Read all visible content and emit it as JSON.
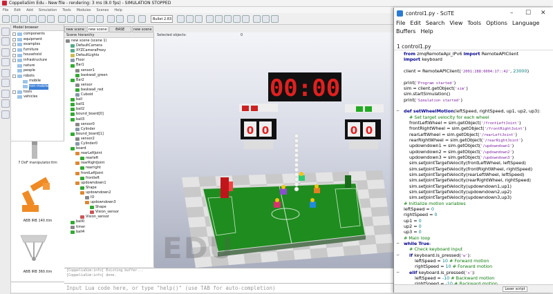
{
  "coppelia": {
    "title": "CoppeliaSim Edu - New file - rendering: 3 ms (8.0 fps) - SIMULATION STOPPED",
    "menu": [
      "File",
      "Edit",
      "Add",
      "Simulation",
      "Tools",
      "Modules",
      "Scenes",
      "Help"
    ],
    "engine_dropdown": "Bullet 2.83",
    "model_browser": {
      "header": "Model browser",
      "items": [
        {
          "label": "components",
          "fold": true
        },
        {
          "label": "equipment",
          "fold": true
        },
        {
          "label": "examples",
          "fold": true
        },
        {
          "label": "furniture",
          "fold": true
        },
        {
          "label": "household",
          "fold": true
        },
        {
          "label": "infrastructure",
          "fold": true
        },
        {
          "label": "nature",
          "fold": false
        },
        {
          "label": "people",
          "fold": false
        },
        {
          "label": "robots",
          "fold": true
        },
        {
          "label": "mobile",
          "fold": false,
          "indent": 1
        },
        {
          "label": "non-mobile",
          "fold": false,
          "indent": 1,
          "selected": true
        },
        {
          "label": "tools",
          "fold": true
        },
        {
          "label": "vehicles",
          "fold": false
        }
      ],
      "models": [
        "7 DoF manipulator.ttm",
        "ABB IRB 140.ttm",
        "ABB IRB 360.ttm"
      ]
    },
    "scene_tabs": [
      "new scene",
      "new scene",
      "BASE",
      "new scene"
    ],
    "scene_hierarchy": {
      "header": "Scene hierarchy",
      "rows": [
        {
          "label": "new scene (scene 1)",
          "indent": 0,
          "color": "#888"
        },
        {
          "label": "DefaultCamera",
          "indent": 1,
          "color": "#5a8"
        },
        {
          "label": "XYZCameraProxy",
          "indent": 1,
          "color": "#5a8"
        },
        {
          "label": "DefaultLights",
          "indent": 1,
          "color": "#cb5"
        },
        {
          "label": "Floor",
          "indent": 1,
          "color": "#89a"
        },
        {
          "label": "Bar1",
          "indent": 1,
          "color": "#3a3"
        },
        {
          "label": "sensor1",
          "indent": 2,
          "color": "#888"
        },
        {
          "label": "baskwall_green",
          "indent": 2,
          "color": "#3a3"
        },
        {
          "label": "Bar2",
          "indent": 1,
          "color": "#3a3"
        },
        {
          "label": "sensor",
          "indent": 2,
          "color": "#888"
        },
        {
          "label": "baskwall_red",
          "indent": 2,
          "color": "#3a3"
        },
        {
          "label": "Cuboid",
          "indent": 2,
          "color": "#89a"
        },
        {
          "label": "ball",
          "indent": 1,
          "color": "#3a3"
        },
        {
          "label": "ball1",
          "indent": 1,
          "color": "#3a3"
        },
        {
          "label": "ball2",
          "indent": 1,
          "color": "#3a3"
        },
        {
          "label": "bound_board[0]",
          "indent": 1,
          "color": "#3a3"
        },
        {
          "label": "ball3",
          "indent": 1,
          "color": "#3a3"
        },
        {
          "label": "sensor0",
          "indent": 2,
          "color": "#888"
        },
        {
          "label": "Cylinder",
          "indent": 2,
          "color": "#89a"
        },
        {
          "label": "bound_board[1]",
          "indent": 1,
          "color": "#3a3"
        },
        {
          "label": "sensor2",
          "indent": 2,
          "color": "#888"
        },
        {
          "label": "Cylinder0",
          "indent": 2,
          "color": "#89a"
        },
        {
          "label": "board",
          "indent": 1,
          "color": "#3a3"
        },
        {
          "label": "rearLeftJoint",
          "indent": 2,
          "color": "#d83"
        },
        {
          "label": "rearleft",
          "indent": 3,
          "color": "#3a3"
        },
        {
          "label": "rearRightJoint",
          "indent": 2,
          "color": "#d83"
        },
        {
          "label": "rearright",
          "indent": 3,
          "color": "#3a3"
        },
        {
          "label": "frontLeftJoint",
          "indent": 2,
          "color": "#d83"
        },
        {
          "label": "frontleft",
          "indent": 3,
          "color": "#3a3"
        },
        {
          "label": "updowndown1",
          "indent": 2,
          "color": "#d83"
        },
        {
          "label": "Shape",
          "indent": 3,
          "color": "#3a3"
        },
        {
          "label": "updowndown2",
          "indent": 3,
          "color": "#d83"
        },
        {
          "label": "IO",
          "indent": 4,
          "color": "#888"
        },
        {
          "label": "updowndown3",
          "indent": 4,
          "color": "#d83"
        },
        {
          "label": "Shape",
          "indent": 5,
          "color": "#3a3"
        },
        {
          "label": "Vision_sensor",
          "indent": 5,
          "color": "#c55"
        },
        {
          "label": "Vision_sensor",
          "indent": 3,
          "color": "#c55"
        },
        {
          "label": "ball0",
          "indent": 1,
          "color": "#3a3"
        },
        {
          "label": "timer",
          "indent": 1,
          "color": "#888"
        },
        {
          "label": "ball4",
          "indent": 1,
          "color": "#3a3"
        }
      ]
    },
    "viewport": {
      "selected_objects_label": "Selected objects:",
      "selected_count": "0",
      "score_display": "00:00",
      "left_scores": [
        "0",
        "0"
      ],
      "right_scores": [
        "0",
        "0"
      ],
      "watermark": "EDU",
      "colors": {
        "field": "#1f8c1f",
        "floor_light": "#e4e4e4",
        "floor_dark": "#c9c9c9",
        "scoreboard": "#111",
        "score_red": "#e02020"
      }
    },
    "console": {
      "lines": [
        "[CoppeliaSim:info]   Existing buffer...",
        "[CoppeliaSim:info]   done."
      ],
      "input_placeholder": "Input Lua code here, or type \"help()\" (use TAB for auto-completion)"
    }
  },
  "scite": {
    "title": "control1.py - SciTE",
    "menu": [
      "File",
      "Edit",
      "Search",
      "View",
      "Tools",
      "Options",
      "Language",
      "Buffers",
      "Help"
    ],
    "tab": "1 control1.py",
    "lexer": "Lexer script",
    "code": [
      {
        "fold": "",
        "ind": 0,
        "t": [
          [
            "kw",
            "from "
          ],
          [
            "id",
            "zmqRemoteApi_IPv6 "
          ],
          [
            "kw",
            "import "
          ],
          [
            "id",
            "RemoteAPIClient"
          ]
        ]
      },
      {
        "fold": "",
        "ind": 0,
        "t": [
          [
            "kw",
            "import "
          ],
          [
            "id",
            "keyboard"
          ]
        ]
      },
      {
        "fold": "",
        "ind": 0,
        "t": []
      },
      {
        "fold": "",
        "ind": 0,
        "t": [
          [
            "id",
            "client = RemoteAPIClient("
          ],
          [
            "str",
            "'2001:288:6004:17::42'"
          ],
          [
            "id",
            ", "
          ],
          [
            "num",
            "23000"
          ],
          [
            "id",
            ")"
          ]
        ]
      },
      {
        "fold": "",
        "ind": 0,
        "t": []
      },
      {
        "fold": "",
        "ind": 0,
        "t": [
          [
            "id",
            "print("
          ],
          [
            "str",
            "'Program started'"
          ],
          [
            "id",
            ")"
          ]
        ]
      },
      {
        "fold": "",
        "ind": 0,
        "t": [
          [
            "id",
            "sim = client.getObject("
          ],
          [
            "str",
            "'sim'"
          ],
          [
            "id",
            ")"
          ]
        ]
      },
      {
        "fold": "",
        "ind": 0,
        "t": [
          [
            "id",
            "sim.startSimulation()"
          ]
        ]
      },
      {
        "fold": "",
        "ind": 0,
        "t": [
          [
            "id",
            "print("
          ],
          [
            "str",
            "'Simulation started'"
          ],
          [
            "id",
            ")"
          ]
        ]
      },
      {
        "fold": "",
        "ind": 0,
        "t": []
      },
      {
        "fold": "−",
        "ind": 0,
        "t": [
          [
            "kw",
            "def "
          ],
          [
            "fn",
            "setWheelMotion"
          ],
          [
            "id",
            "(leftSpeed, rightSpeed, up1, up2, up3):"
          ]
        ]
      },
      {
        "fold": "",
        "ind": 1,
        "t": [
          [
            "cm",
            "# Set target velocity for each wheel"
          ]
        ]
      },
      {
        "fold": "",
        "ind": 1,
        "t": [
          [
            "id",
            "frontLeftWheel = sim.getObject("
          ],
          [
            "str",
            "'/frontLeftJoint'"
          ],
          [
            "id",
            ")"
          ]
        ]
      },
      {
        "fold": "",
        "ind": 1,
        "t": [
          [
            "id",
            "frontRightWheel = sim.getObject("
          ],
          [
            "str",
            "'/frontRightJoint'"
          ],
          [
            "id",
            ")"
          ]
        ]
      },
      {
        "fold": "",
        "ind": 1,
        "t": [
          [
            "id",
            "rearLeftWheel = sim.getObject("
          ],
          [
            "str",
            "'/rearLeftJoint'"
          ],
          [
            "id",
            ")"
          ]
        ]
      },
      {
        "fold": "",
        "ind": 1,
        "t": [
          [
            "id",
            "rearRightWheel = sim.getObject("
          ],
          [
            "str",
            "'/rearRightJoint'"
          ],
          [
            "id",
            ")"
          ]
        ]
      },
      {
        "fold": "",
        "ind": 1,
        "t": [
          [
            "id",
            "updowndown1 = sim.getObject("
          ],
          [
            "str",
            "'/updowndown1'"
          ],
          [
            "id",
            ")"
          ]
        ]
      },
      {
        "fold": "",
        "ind": 1,
        "t": [
          [
            "id",
            "updowndown2 = sim.getObject("
          ],
          [
            "str",
            "'/updowndown2'"
          ],
          [
            "id",
            ")"
          ]
        ]
      },
      {
        "fold": "",
        "ind": 1,
        "t": [
          [
            "id",
            "updowndown3 = sim.getObject("
          ],
          [
            "str",
            "'/updowndown3'"
          ],
          [
            "id",
            ")"
          ]
        ]
      },
      {
        "fold": "",
        "ind": 1,
        "t": [
          [
            "id",
            "sim.setJointTargetVelocity(frontLeftWheel, leftSpeed)"
          ]
        ]
      },
      {
        "fold": "",
        "ind": 1,
        "t": [
          [
            "id",
            "sim.setJointTargetVelocity(frontRightWheel, rightSpeed)"
          ]
        ]
      },
      {
        "fold": "",
        "ind": 1,
        "t": [
          [
            "id",
            "sim.setJointTargetVelocity(rearLeftWheel, leftSpeed)"
          ]
        ]
      },
      {
        "fold": "",
        "ind": 1,
        "t": [
          [
            "id",
            "sim.setJointTargetVelocity(rearRightWheel, rightSpeed)"
          ]
        ]
      },
      {
        "fold": "",
        "ind": 1,
        "t": [
          [
            "id",
            "sim.setJointTargetVelocity(updowndown1,up1)"
          ]
        ]
      },
      {
        "fold": "",
        "ind": 1,
        "t": [
          [
            "id",
            "sim.setJointTargetVelocity(updowndown2,up2)"
          ]
        ]
      },
      {
        "fold": "",
        "ind": 1,
        "t": [
          [
            "id",
            "sim.setJointTargetVelocity(updowndown3,up3)"
          ]
        ]
      },
      {
        "fold": "",
        "ind": 0,
        "t": [
          [
            "cm",
            "# Initialize motion variables"
          ]
        ]
      },
      {
        "fold": "",
        "ind": 0,
        "t": [
          [
            "id",
            "leftSpeed = "
          ],
          [
            "num",
            "0"
          ]
        ]
      },
      {
        "fold": "",
        "ind": 0,
        "t": [
          [
            "id",
            "rightSpeed = "
          ],
          [
            "num",
            "0"
          ]
        ]
      },
      {
        "fold": "",
        "ind": 0,
        "t": [
          [
            "id",
            "up1 = "
          ],
          [
            "num",
            "0"
          ]
        ]
      },
      {
        "fold": "",
        "ind": 0,
        "t": [
          [
            "id",
            "up2 = "
          ],
          [
            "num",
            "0"
          ]
        ]
      },
      {
        "fold": "",
        "ind": 0,
        "t": [
          [
            "id",
            "up3 = "
          ],
          [
            "num",
            "0"
          ]
        ]
      },
      {
        "fold": "",
        "ind": 0,
        "t": [
          [
            "cm",
            "# Main loop"
          ]
        ]
      },
      {
        "fold": "−",
        "ind": 0,
        "t": [
          [
            "kw",
            "while "
          ],
          [
            "kw",
            "True"
          ],
          [
            "id",
            ":"
          ]
        ]
      },
      {
        "fold": "",
        "ind": 1,
        "t": [
          [
            "cm",
            "# Check keyboard input"
          ]
        ]
      },
      {
        "fold": "−",
        "ind": 1,
        "t": [
          [
            "kw",
            "if "
          ],
          [
            "id",
            "keyboard.is_pressed("
          ],
          [
            "str",
            "'w'"
          ],
          [
            "id",
            "):"
          ]
        ]
      },
      {
        "fold": "",
        "ind": 2,
        "t": [
          [
            "id",
            "leftSpeed = "
          ],
          [
            "num",
            "10 "
          ],
          [
            "cm",
            "# Forward motion"
          ]
        ]
      },
      {
        "fold": "",
        "ind": 2,
        "t": [
          [
            "id",
            "rightSpeed = "
          ],
          [
            "num",
            "10 "
          ],
          [
            "cm",
            "# Forward motion"
          ]
        ]
      },
      {
        "fold": "−",
        "ind": 1,
        "t": [
          [
            "kw",
            "elif "
          ],
          [
            "id",
            "keyboard.is_pressed("
          ],
          [
            "str",
            "'s'"
          ],
          [
            "id",
            "):"
          ]
        ]
      },
      {
        "fold": "",
        "ind": 2,
        "t": [
          [
            "id",
            "leftSpeed = "
          ],
          [
            "num",
            "-10 "
          ],
          [
            "cm",
            "# Backward motion"
          ]
        ]
      },
      {
        "fold": "",
        "ind": 2,
        "t": [
          [
            "id",
            "rightSpeed = "
          ],
          [
            "num",
            "-10 "
          ],
          [
            "cm",
            "# Backward motion"
          ]
        ]
      }
    ]
  }
}
